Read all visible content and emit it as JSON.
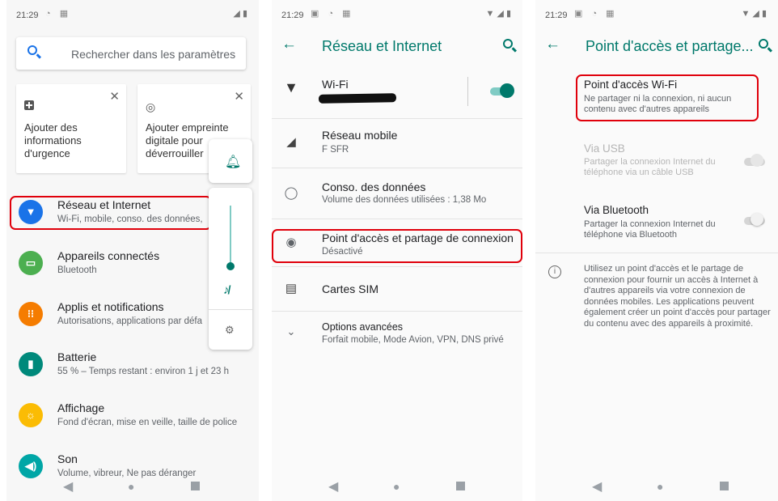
{
  "status": {
    "time": "21:29"
  },
  "settings": {
    "search_placeholder": "Rechercher dans les paramètres",
    "suggestions": [
      {
        "label": "Ajouter des informations d'urgence",
        "icon": "medical-icon"
      },
      {
        "label": "Ajouter empreinte digitale pour déverrouiller",
        "icon": "fingerprint-icon"
      }
    ],
    "items": [
      {
        "title": "Réseau et Internet",
        "subtitle": "Wi-Fi, mobile, conso. des données,",
        "icon": "wifi-icon",
        "color": "#1a73e8"
      },
      {
        "title": "Appareils connectés",
        "subtitle": "Bluetooth",
        "icon": "devices-icon",
        "color": "#4caf50"
      },
      {
        "title": "Applis et notifications",
        "subtitle": "Autorisations, applications par défa",
        "icon": "apps-icon",
        "color": "#f57c00"
      },
      {
        "title": "Batterie",
        "subtitle": "55 % – Temps restant : environ 1 j et 23 h",
        "icon": "battery-icon",
        "color": "#00897b"
      },
      {
        "title": "Affichage",
        "subtitle": "Fond d'écran, mise en veille, taille de police",
        "icon": "display-icon",
        "color": "#fbbc04"
      },
      {
        "title": "Son",
        "subtitle": "Volume, vibreur, Ne pas déranger",
        "icon": "sound-icon",
        "color": "#00a6a6"
      }
    ]
  },
  "network": {
    "title": "Réseau et Internet",
    "items": [
      {
        "title": "Wi-Fi",
        "subtitle": "",
        "icon": "wifi-icon"
      },
      {
        "title": "Réseau mobile",
        "subtitle": "F SFR",
        "icon": "signal-icon"
      },
      {
        "title": "Conso. des données",
        "subtitle": "Volume des données utilisées : 1,38 Mo",
        "icon": "data-usage-icon"
      },
      {
        "title": "Point d'accès et partage de connexion",
        "subtitle": "Désactivé",
        "icon": "hotspot-icon"
      },
      {
        "title": "Cartes SIM",
        "subtitle": "",
        "icon": "sim-icon"
      },
      {
        "title": "Options avancées",
        "subtitle": "Forfait mobile, Mode Avion, VPN, DNS privé",
        "icon": "chevron-down-icon"
      }
    ]
  },
  "hotspot": {
    "title": "Point d'accès et partage...",
    "wifi": {
      "title": "Point d'accès Wi-Fi",
      "subtitle": "Ne partager ni la connexion, ni aucun contenu avec d'autres appareils"
    },
    "usb": {
      "title": "Via USB",
      "subtitle": "Partager la connexion Internet du téléphone via un câble USB"
    },
    "bluetooth": {
      "title": "Via Bluetooth",
      "subtitle": "Partager la connexion Internet du téléphone via Bluetooth"
    },
    "info": "Utilisez un point d'accès et le partage de connexion pour fournir un accès à Internet à d'autres appareils via votre connexion de données mobiles. Les applications peuvent également créer un point d'accès pour partager du contenu avec des appareils à proximité."
  },
  "colors": {
    "accent": "#00796b",
    "highlight": "#e0000b"
  }
}
